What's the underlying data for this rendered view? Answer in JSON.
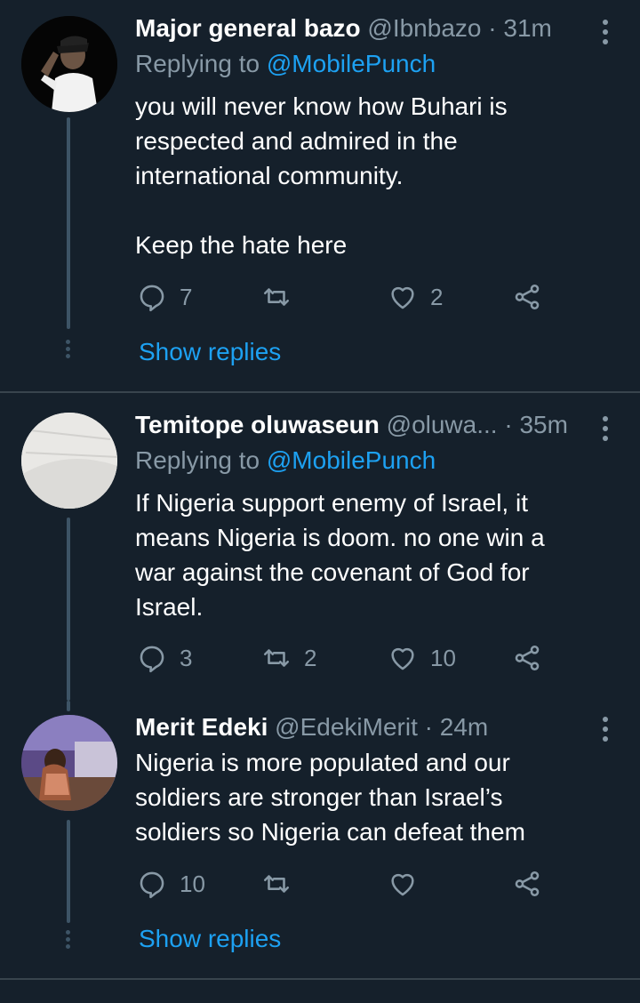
{
  "tweets": [
    {
      "name": "Major general bazo",
      "handle": "@Ibnbazo",
      "time": "31m",
      "replying_prefix": "Replying to ",
      "replying_to": "@MobilePunch",
      "text": "you will never know how Buhari is\nrespected and admired in the\ninternational community.\n\nKeep the hate here",
      "replies": "7",
      "retweets": "",
      "likes": "2",
      "show_replies": "Show replies"
    },
    {
      "name": "Temitope oluwaseun",
      "handle": "@oluwa...",
      "time": "35m",
      "replying_prefix": "Replying to ",
      "replying_to": "@MobilePunch",
      "text": "If Nigeria support enemy of Israel, it\nmeans Nigeria is doom. no one win a\nwar against the covenant of God for\nIsrael.",
      "replies": "3",
      "retweets": "2",
      "likes": "10"
    },
    {
      "name": "Merit Edeki",
      "handle": "@EdekiMerit",
      "time": "24m",
      "text": "Nigeria is more populated and our\nsoldiers are stronger than Israel’s\nsoldiers so Nigeria can defeat them",
      "replies": "10",
      "retweets": "",
      "likes": "",
      "show_replies": "Show replies"
    }
  ],
  "separator": "·",
  "colors": {
    "background": "#15202b",
    "text": "#ffffff",
    "secondary": "#8899a6",
    "accent": "#1da1f2",
    "divider": "#38444d",
    "thread_line": "#3d5466"
  }
}
